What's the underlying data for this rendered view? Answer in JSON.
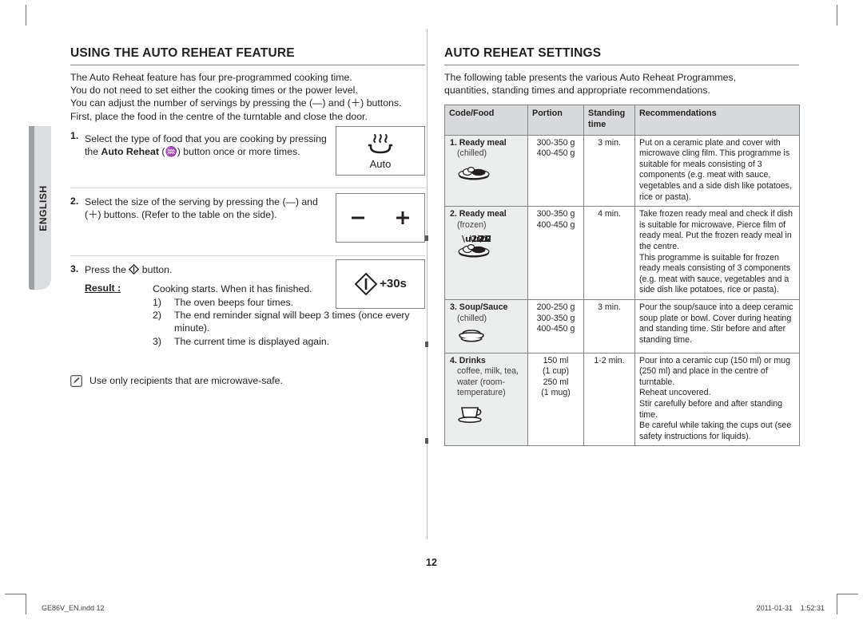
{
  "sidebar": {
    "language_tab": "ENGLISH"
  },
  "left": {
    "title": "USING THE AUTO REHEAT FEATURE",
    "intro": [
      "The Auto Reheat feature has four pre-programmed cooking time.",
      "You do not need to set either the cooking times or the power level.",
      "You can adjust the number of servings by pressing the (—) and (＋) buttons.",
      "First, place the food in the centre of the turntable and close the door."
    ],
    "steps": [
      {
        "num": "1.",
        "text_before": "Select the type of food that you are cooking by pressing the ",
        "bold": "Auto Reheat",
        "text_after": " (♒) button once or more times.",
        "panel": {
          "icon_name": "auto-reheat-icon",
          "waves": "∫∫∫",
          "label": "Auto"
        }
      },
      {
        "num": "2.",
        "text": "Select the size of the serving by pressing the (—) and (＋) buttons. (Refer to the table on the side).",
        "panel": {
          "icon_name": "minus-plus-icon",
          "minus": "—",
          "plus": "＋"
        }
      },
      {
        "num": "3.",
        "text_before": "Press the ",
        "glyph": "◇",
        "text_after": " button.",
        "result_label": "Result :",
        "result_text": "Cooking starts. When it has finished.",
        "result_items": [
          {
            "marker": "1)",
            "text": "The oven beeps four times."
          },
          {
            "marker": "2)",
            "text": "The end reminder signal will beep 3 times (once every minute)."
          },
          {
            "marker": "3)",
            "text": "The current time is displayed again."
          }
        ],
        "panel": {
          "icon_name": "start-plus-30s-icon",
          "label": "+30s"
        }
      }
    ],
    "note": {
      "icon_name": "note-pencil-icon",
      "text": "Use only recipients that are microwave-safe."
    }
  },
  "right": {
    "title": "AUTO REHEAT SETTINGS",
    "intro": [
      "The following table presents the various Auto Reheat Programmes,",
      "quantities, standing times and appropriate recommendations."
    ],
    "table": {
      "headers": [
        "Code/Food",
        "Portion",
        "Standing time",
        "Recommendations"
      ],
      "rows": [
        {
          "code": "1. Ready meal",
          "sub": "(chilled)",
          "icon_name": "plate-food-icon",
          "portion": [
            "300-350 g",
            "400-450 g"
          ],
          "standing": "3 min.",
          "recommend": [
            "Put on a ceramic plate and cover with microwave cling film. This programme is suitable for meals consisting of 3 components (e.g. meat with sauce, vegetables and a side dish like potatoes, rice or pasta)."
          ]
        },
        {
          "code": "2. Ready meal",
          "sub": "(frozen)",
          "icon_name": "frozen-plate-food-icon",
          "portion": [
            "300-350 g",
            "400-450 g"
          ],
          "standing": "4 min.",
          "recommend": [
            "Take frozen ready meal and check if dish is suitable for microwave. Pierce film of ready meal. Put the frozen ready meal in the centre.",
            "This programme is suitable for frozen ready meals consisting of 3 components (e.g. meat with sauce, vegetables and a side dish like potatoes, rice or pasta)."
          ]
        },
        {
          "code": "3. Soup/Sauce",
          "sub": "(chilled)",
          "icon_name": "soup-bowl-icon",
          "portion": [
            "200-250 g",
            "300-350 g",
            "400-450 g"
          ],
          "standing": "3 min.",
          "recommend": [
            "Pour the soup/sauce into a deep ceramic soup plate or bowl. Cover during heating and standing time. Stir before and after standing time."
          ]
        },
        {
          "code": "4. Drinks",
          "sub": "coffee, milk, tea, water (room-temperature)",
          "icon_name": "coffee-cup-icon",
          "portion": [
            "150 ml",
            "(1 cup)",
            "250 ml",
            "(1 mug)"
          ],
          "standing": "1-2 min.",
          "recommend": [
            "Pour into a ceramic cup (150 ml) or mug (250 ml) and place in the centre of turntable.",
            "Reheat uncovered.",
            "Stir carefully before and after standing time.",
            "Be careful while taking the cups out (see safety instructions for liquids)."
          ]
        }
      ]
    }
  },
  "page_number": "12",
  "footer": {
    "file": "GE86V_EN.indd   12",
    "timestamp": "2011-01-31    1:52:31"
  }
}
